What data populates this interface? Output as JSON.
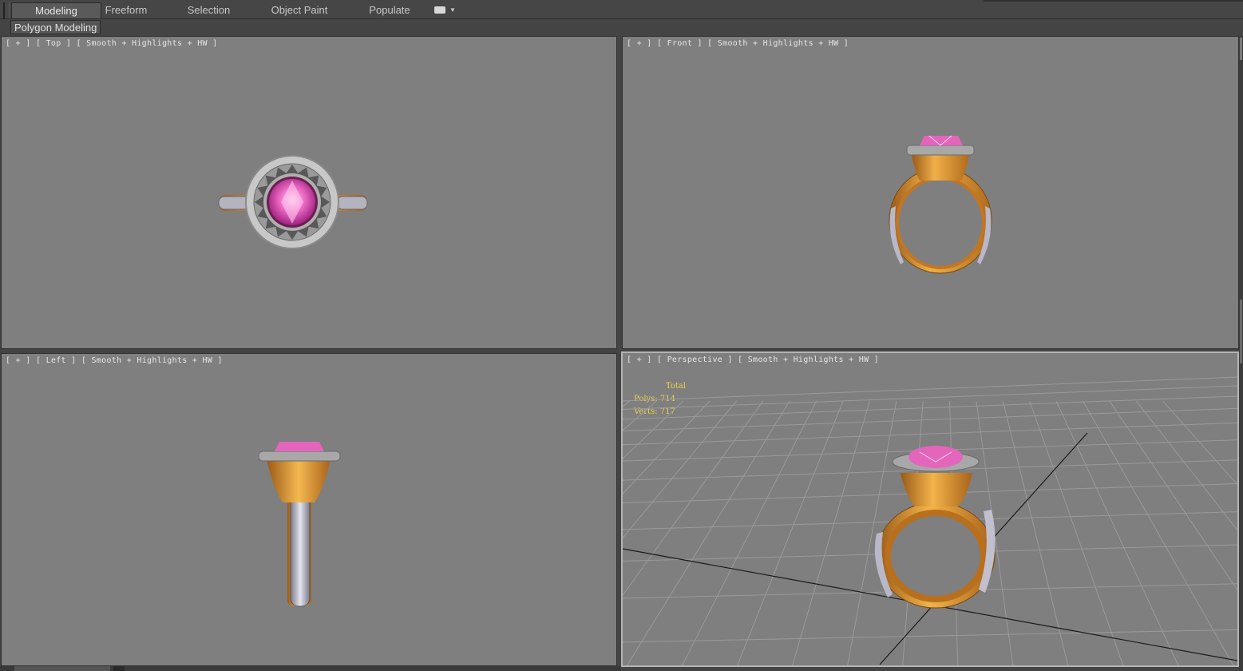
{
  "ribbon": {
    "tabs": [
      {
        "label": "Modeling",
        "active": true
      },
      {
        "label": "Freeform",
        "active": false
      },
      {
        "label": "Selection",
        "active": false
      },
      {
        "label": "Object Paint",
        "active": false
      },
      {
        "label": "Populate",
        "active": false
      }
    ],
    "more_icon": "dropdown-icon",
    "panel_label": "Polygon Modeling"
  },
  "viewports": {
    "top": {
      "plus": "[ + ]",
      "view": "[ Top ]",
      "shading": "[ Smooth + Highlights + HW ]"
    },
    "front": {
      "plus": "[ + ]",
      "view": "[ Front ]",
      "shading": "[ Smooth + Highlights + HW ]"
    },
    "left": {
      "plus": "[ + ]",
      "view": "[ Left ]",
      "shading": "[ Smooth + Highlights + HW ]"
    },
    "perspective": {
      "plus": "[ + ]",
      "view": "[ Perspective ]",
      "shading": "[ Smooth + Highlights + HW ]",
      "stats": {
        "header": "Total",
        "polys": "Polys: 714",
        "verts": "Verts: 717"
      }
    }
  },
  "colors": {
    "viewport_bg": "#7f7f7f",
    "stats_text": "#e8d34a",
    "gem": "#e060b8",
    "gold": "#d8962e",
    "silver": "#b8b8c4"
  }
}
